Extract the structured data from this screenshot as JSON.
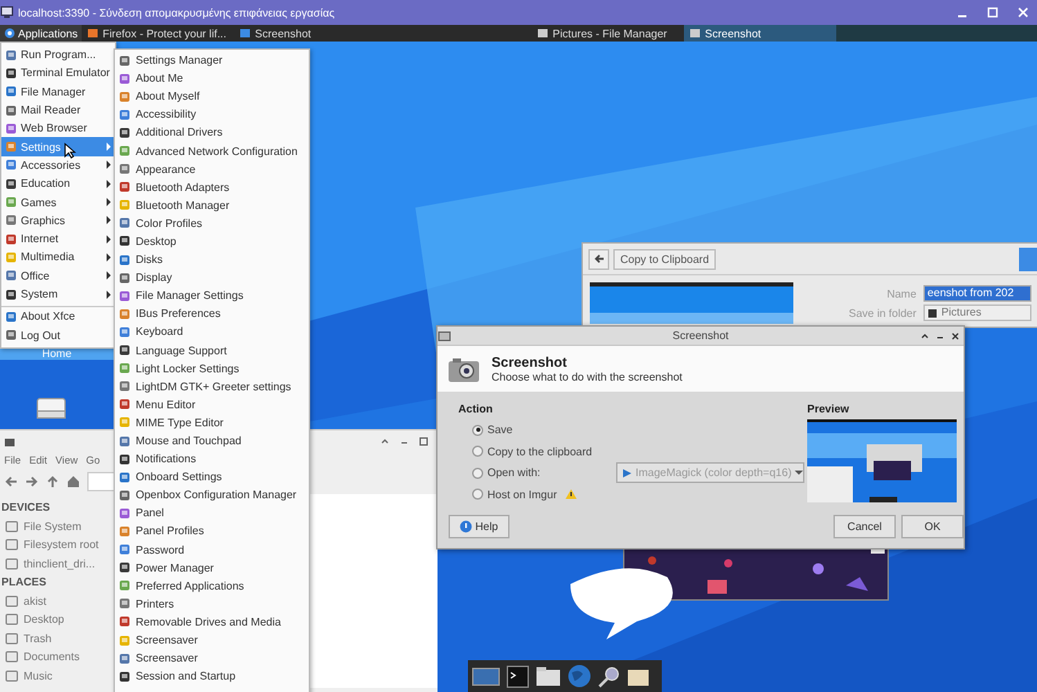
{
  "window": {
    "title": "localhost:3390 - Σύνδεση απομακρυσμένης επιφάνειας εργασίας"
  },
  "panel": {
    "menu_button": "Applications",
    "tasks": [
      {
        "label": "Firefox - Protect your lif...",
        "selected": false
      },
      {
        "label": "Screenshot",
        "selected": false
      },
      {
        "label": "Pictures - File Manager",
        "selected": false
      },
      {
        "label": "Screenshot",
        "selected": true
      }
    ]
  },
  "applications_menu": {
    "items": [
      {
        "label": "Run Program...",
        "submenu": false,
        "selected": false
      },
      {
        "label": "Terminal Emulator",
        "submenu": false,
        "selected": false
      },
      {
        "label": "File Manager",
        "submenu": false,
        "selected": false
      },
      {
        "label": "Mail Reader",
        "submenu": false,
        "selected": false
      },
      {
        "label": "Web Browser",
        "submenu": false,
        "selected": false
      },
      {
        "label": "Settings",
        "submenu": true,
        "selected": true
      },
      {
        "label": "Accessories",
        "submenu": true,
        "selected": false
      },
      {
        "label": "Education",
        "submenu": true,
        "selected": false
      },
      {
        "label": "Games",
        "submenu": true,
        "selected": false
      },
      {
        "label": "Graphics",
        "submenu": true,
        "selected": false
      },
      {
        "label": "Internet",
        "submenu": true,
        "selected": false
      },
      {
        "label": "Multimedia",
        "submenu": true,
        "selected": false
      },
      {
        "label": "Office",
        "submenu": true,
        "selected": false
      },
      {
        "label": "System",
        "submenu": true,
        "selected": false
      },
      {
        "label": "About Xfce",
        "submenu": false,
        "selected": false,
        "separator_before": true
      },
      {
        "label": "Log Out",
        "submenu": false,
        "selected": false
      }
    ]
  },
  "settings_submenu": {
    "items": [
      "Settings Manager",
      "About Me",
      "About Myself",
      "Accessibility",
      "Additional Drivers",
      "Advanced Network Configuration",
      "Appearance",
      "Bluetooth Adapters",
      "Bluetooth Manager",
      "Color Profiles",
      "Desktop",
      "Disks",
      "Display",
      "File Manager Settings",
      "IBus Preferences",
      "Keyboard",
      "Language Support",
      "Light Locker Settings",
      "LightDM GTK+ Greeter settings",
      "Menu Editor",
      "MIME Type Editor",
      "Mouse and Touchpad",
      "Notifications",
      "Onboard Settings",
      "Openbox Configuration Manager",
      "Panel",
      "Panel Profiles",
      "Password",
      "Power Manager",
      "Preferred Applications",
      "Printers",
      "Removable Drives and Media",
      "Screensaver",
      "Screensaver",
      "Session and Startup"
    ]
  },
  "desktop_icons": [
    {
      "label": "Home"
    }
  ],
  "file_manager": {
    "menu": [
      "File",
      "Edit",
      "View",
      "Go"
    ],
    "sidebar": [
      {
        "heading": "DEVICES",
        "items": [
          "File System",
          "Filesystem root",
          "thinclient_dri..."
        ]
      },
      {
        "heading": "PLACES",
        "items": [
          "akist",
          "Desktop",
          "Trash",
          "Documents",
          "Music"
        ]
      }
    ]
  },
  "save_window": {
    "button": "Copy to Clipboard",
    "name_label": "Name",
    "name_value": "eenshot from 202",
    "folder_label": "Save in folder",
    "folder_value": "Pictures"
  },
  "screenshot_dialog": {
    "title": "Screenshot",
    "heading": "Screenshot",
    "subheading": "Choose what to do with the screenshot",
    "action_label": "Action",
    "options": [
      {
        "label": "Save",
        "selected": true,
        "warning": false
      },
      {
        "label": "Copy to the clipboard",
        "selected": false,
        "warning": false
      },
      {
        "label": "Open with:",
        "selected": false,
        "warning": false
      },
      {
        "label": "Host on Imgur",
        "selected": false,
        "warning": true
      }
    ],
    "open_with": {
      "value": "ImageMagick (color depth=q16)",
      "disabled": true
    },
    "preview_label": "Preview",
    "buttons": [
      {
        "label": "Help",
        "kind": "help"
      },
      {
        "label": "Cancel",
        "kind": "plain"
      },
      {
        "label": "OK",
        "kind": "plain"
      }
    ]
  }
}
